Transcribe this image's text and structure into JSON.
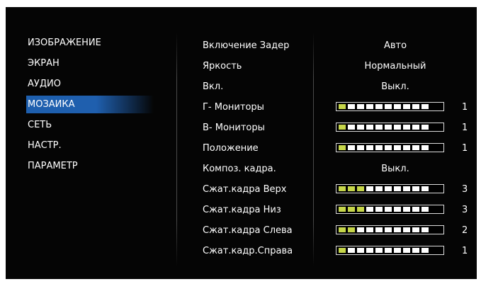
{
  "menu": {
    "items": [
      {
        "label": "ИЗОБРАЖЕНИЕ",
        "selected": false
      },
      {
        "label": "ЭКРАН",
        "selected": false
      },
      {
        "label": "АУДИО",
        "selected": false
      },
      {
        "label": "МОЗАИКА",
        "selected": true
      },
      {
        "label": "СЕТЬ",
        "selected": false
      },
      {
        "label": "НАСТР.",
        "selected": false
      },
      {
        "label": "ПАРАМЕТР",
        "selected": false
      }
    ],
    "selected_color": "#1f5fae"
  },
  "settings": [
    {
      "label": "Включение Задер",
      "type": "text",
      "value": "Авто"
    },
    {
      "label": "Яркость",
      "type": "text",
      "value": "Нормальный"
    },
    {
      "label": "Вкл.",
      "type": "text",
      "value": "Выкл."
    },
    {
      "label": "Г- Мониторы",
      "type": "bar",
      "value": "1",
      "level": 1,
      "max": 10
    },
    {
      "label": "В- Мониторы",
      "type": "bar",
      "value": "1",
      "level": 1,
      "max": 10
    },
    {
      "label": "Положение",
      "type": "bar",
      "value": "1",
      "level": 1,
      "max": 10
    },
    {
      "label": "Композ. кадра.",
      "type": "text",
      "value": "Выкл."
    },
    {
      "label": "Сжат.кадра Верх",
      "type": "bar",
      "value": "3",
      "level": 3,
      "max": 10
    },
    {
      "label": "Сжат.кадра Низ",
      "type": "bar",
      "value": "3",
      "level": 3,
      "max": 10
    },
    {
      "label": "Сжат.кадра Слева",
      "type": "bar",
      "value": "2",
      "level": 2,
      "max": 10
    },
    {
      "label": "Сжат.кадр.Справа",
      "type": "bar",
      "value": "1",
      "level": 1,
      "max": 10
    }
  ],
  "colors": {
    "background": "#050505",
    "bar_on": "#c6d64a",
    "bar_off": "#ffffff",
    "text": "#ffffff"
  }
}
